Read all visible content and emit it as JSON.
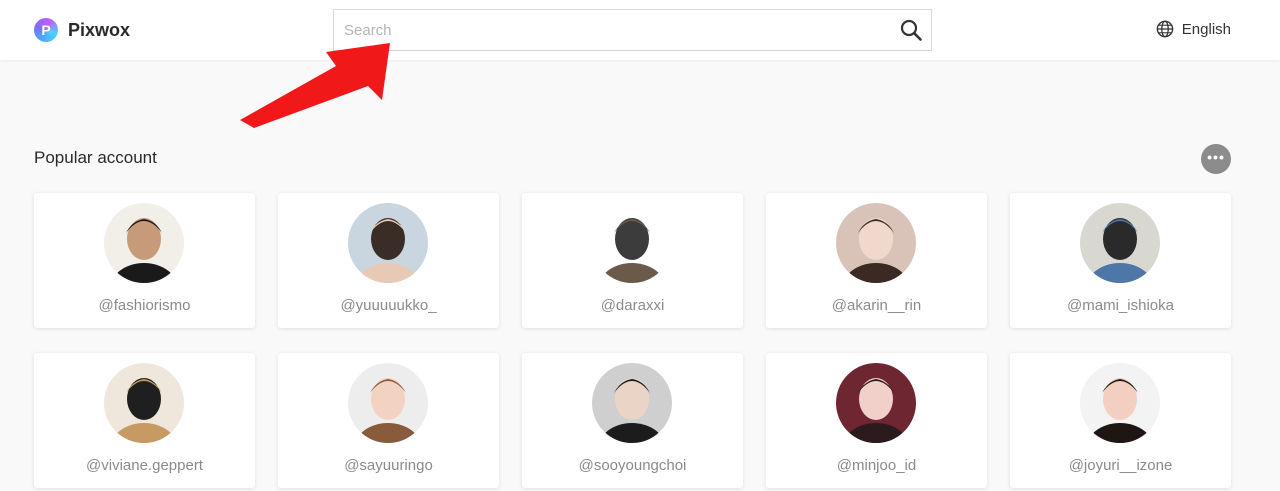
{
  "header": {
    "logo_letter": "P",
    "brand": "Pixwox",
    "search_placeholder": "Search",
    "language": "English"
  },
  "section": {
    "title": "Popular account",
    "more_label": "•••"
  },
  "accounts": [
    {
      "handle": "@fashiorismo",
      "avatar_colors": [
        "#f2eee8",
        "#1a1a1a",
        "#c79a7a"
      ]
    },
    {
      "handle": "@yuuuuukko_",
      "avatar_colors": [
        "#c9d6e0",
        "#e8c9b5",
        "#3a2c26"
      ]
    },
    {
      "handle": "@daraxxi",
      "avatar_colors": [
        "#ffffff",
        "#6b5a4a",
        "#3c3c3c"
      ]
    },
    {
      "handle": "@akarin__rin",
      "avatar_colors": [
        "#d9c2b7",
        "#3b2a24",
        "#f0d9cc"
      ]
    },
    {
      "handle": "@mami_ishioka",
      "avatar_colors": [
        "#d8d8d0",
        "#4f76a8",
        "#2a2a2a"
      ]
    },
    {
      "handle": "@viviane.geppert",
      "avatar_colors": [
        "#efe6dc",
        "#c79a64",
        "#1f1f1f"
      ]
    },
    {
      "handle": "@sayuuringo",
      "avatar_colors": [
        "#ededed",
        "#8a5a3c",
        "#f2d3c2"
      ]
    },
    {
      "handle": "@sooyoungchoi",
      "avatar_colors": [
        "#cfcfcf",
        "#1c1c1c",
        "#e9d4c5"
      ]
    },
    {
      "handle": "@minjoo_id",
      "avatar_colors": [
        "#6e2630",
        "#2b1b1d",
        "#f0d0c8"
      ]
    },
    {
      "handle": "@joyuri__izone",
      "avatar_colors": [
        "#f3f3f3",
        "#1e1612",
        "#f2cfc0"
      ]
    }
  ]
}
